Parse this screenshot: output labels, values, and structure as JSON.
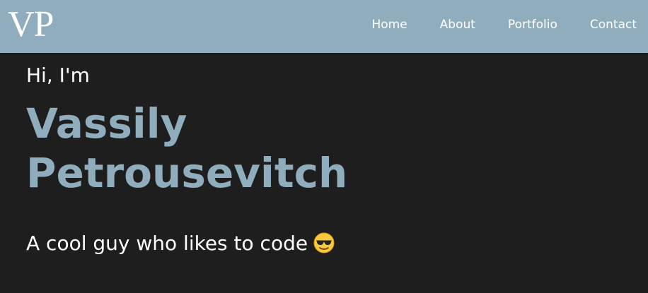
{
  "header": {
    "logo": "VP",
    "nav": [
      {
        "label": "Home"
      },
      {
        "label": "About"
      },
      {
        "label": "Portfolio"
      },
      {
        "label": "Contact"
      }
    ]
  },
  "hero": {
    "greeting": "Hi, I'm",
    "first_name": "Vassily",
    "last_name": "Petrousevitch",
    "tagline": "A cool guy who likes to code",
    "tagline_emoji": "smiling-face-with-sunglasses-icon"
  },
  "colors": {
    "header_bg": "#8fadbc",
    "page_bg": "#1e1e1e",
    "accent": "#8fadbc",
    "text": "#ffffff"
  }
}
